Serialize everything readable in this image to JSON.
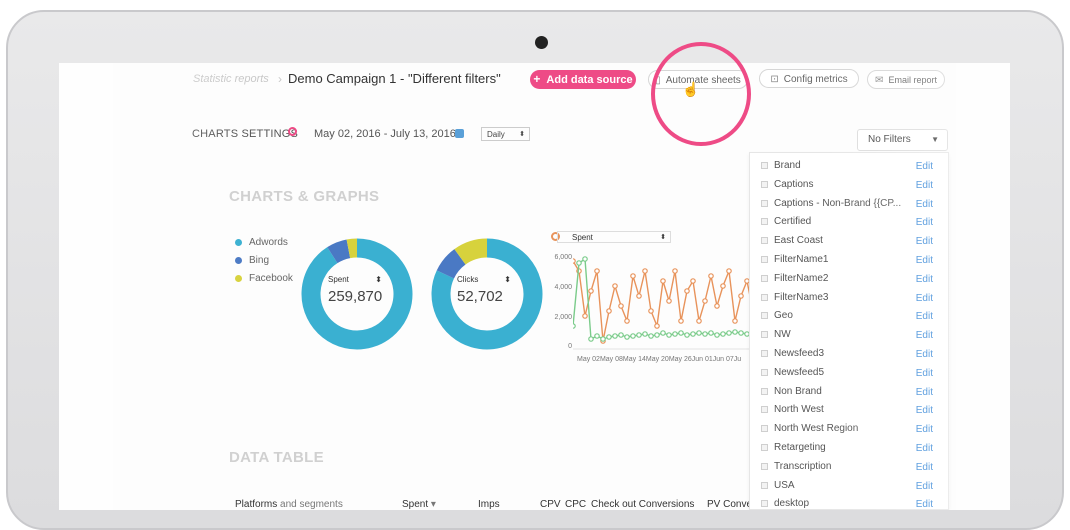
{
  "breadcrumb": {
    "root": "Statistic reports",
    "separator": "›",
    "current": "Demo Campaign 1 - \"Different filters\""
  },
  "toolbar": {
    "add_data_source": "Add data source",
    "automate_sheets": "Automate sheets",
    "config_metrics": "Config metrics",
    "email_report": "Email report"
  },
  "settings": {
    "label": "CHARTS SETTINGS",
    "date_range": "May 02, 2016 - July 13, 2016",
    "granularity": "Daily",
    "filter": "No Filters"
  },
  "charts_title": "CHARTS & GRAPHS",
  "legend": [
    {
      "label": "Adwords",
      "color": "#3ab0d1"
    },
    {
      "label": "Bing",
      "color": "#4a79c4"
    },
    {
      "label": "Facebook",
      "color": "#d7d23c"
    }
  ],
  "donuts": [
    {
      "metric": "Spent",
      "value": "259,870",
      "shares": [
        0.91,
        0.06,
        0.03
      ]
    },
    {
      "metric": "Clicks",
      "value": "52,702",
      "shares": [
        0.82,
        0.08,
        0.1
      ]
    }
  ],
  "line_chart": {
    "metric": "Spent",
    "y_ticks": [
      "6,000",
      "4,000",
      "2,000",
      "0"
    ],
    "x_ticks": "May 02May 08May 14May 20May 26Jun 01Jun 07Ju"
  },
  "filters": [
    {
      "label": "Brand",
      "edit": "Edit"
    },
    {
      "label": "Captions",
      "edit": "Edit"
    },
    {
      "label": "Captions - Non-Brand {{CP...",
      "edit": "Edit"
    },
    {
      "label": "Certified",
      "edit": "Edit"
    },
    {
      "label": "East Coast",
      "edit": "Edit"
    },
    {
      "label": "FilterName1",
      "edit": "Edit"
    },
    {
      "label": "FilterName2",
      "edit": "Edit"
    },
    {
      "label": "FilterName3",
      "edit": "Edit"
    },
    {
      "label": "Geo",
      "edit": "Edit"
    },
    {
      "label": "NW",
      "edit": "Edit"
    },
    {
      "label": "Newsfeed3",
      "edit": "Edit"
    },
    {
      "label": "Newsfeed5",
      "edit": "Edit"
    },
    {
      "label": "Non Brand",
      "edit": "Edit"
    },
    {
      "label": "North West",
      "edit": "Edit"
    },
    {
      "label": "North West Region",
      "edit": "Edit"
    },
    {
      "label": "Retargeting",
      "edit": "Edit"
    },
    {
      "label": "Transcription",
      "edit": "Edit"
    },
    {
      "label": "USA",
      "edit": "Edit"
    },
    {
      "label": "desktop",
      "edit": "Edit"
    }
  ],
  "data_table": {
    "title": "DATA TABLE",
    "headers": {
      "platforms": "Platforms",
      "and_segments": "and segments",
      "spent": "Spent",
      "sort_icon": "▾",
      "imps": "Imps",
      "cpv": "CPV",
      "cpc": "CPC",
      "checkout": "Check out Conversions",
      "pv": "PV Conve"
    }
  }
}
